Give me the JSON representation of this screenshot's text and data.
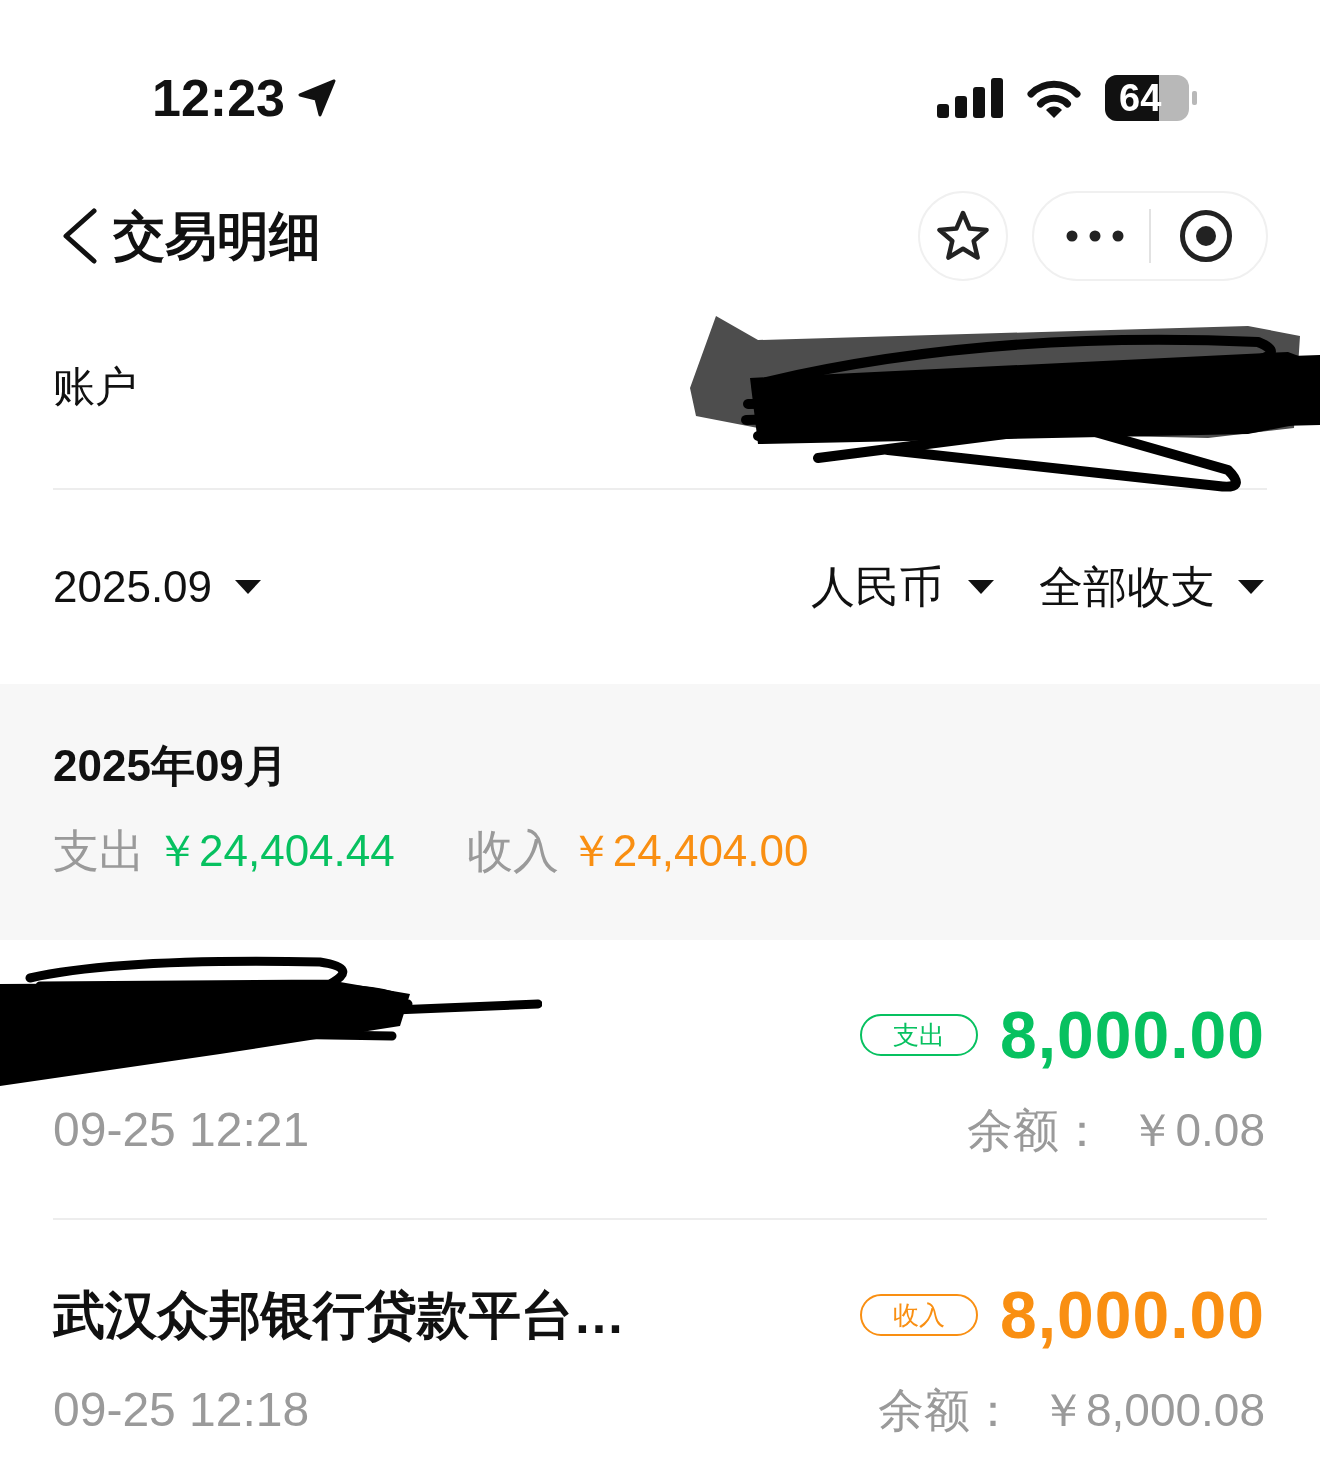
{
  "status_bar": {
    "time": "12:23",
    "battery": "64"
  },
  "nav": {
    "title": "交易明细"
  },
  "account": {
    "label": "账户",
    "value_redacted": true
  },
  "filters": {
    "month": "2025.09",
    "currency": "人民币",
    "type": "全部收支"
  },
  "summary": {
    "title": "2025年09月",
    "expense_label": "支出",
    "expense_amount": "￥24,404.44",
    "income_label": "收入",
    "income_amount": "￥24,404.00"
  },
  "transactions": [
    {
      "kind": "expense",
      "redacted": true,
      "badge": "支出",
      "amount": "8,000.00",
      "time": "09-25 12:21",
      "balance_label": "余额：",
      "balance": "￥0.08"
    },
    {
      "kind": "income",
      "redacted": false,
      "title": "武汉众邦银行贷款平台…",
      "badge": "收入",
      "amount": "8,000.00",
      "time": "09-25 12:18",
      "balance_label": "余额：",
      "balance": "￥8,000.08"
    }
  ]
}
